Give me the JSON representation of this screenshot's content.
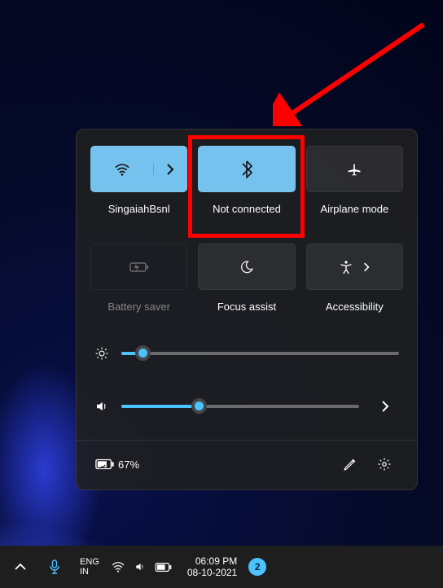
{
  "tiles": {
    "wifi_label": "SingaiahBsnl",
    "bluetooth_label": "Not connected",
    "airplane_label": "Airplane mode",
    "battery_saver_label": "Battery saver",
    "focus_assist_label": "Focus assist",
    "accessibility_label": "Accessibility"
  },
  "sliders": {
    "brightness_pct": 8,
    "volume_pct": 33
  },
  "bottom": {
    "battery_pct": "67%"
  },
  "taskbar": {
    "lang_primary": "ENG",
    "lang_secondary": "IN",
    "time": "06:09 PM",
    "date": "08-10-2021",
    "notification_count": "2"
  }
}
